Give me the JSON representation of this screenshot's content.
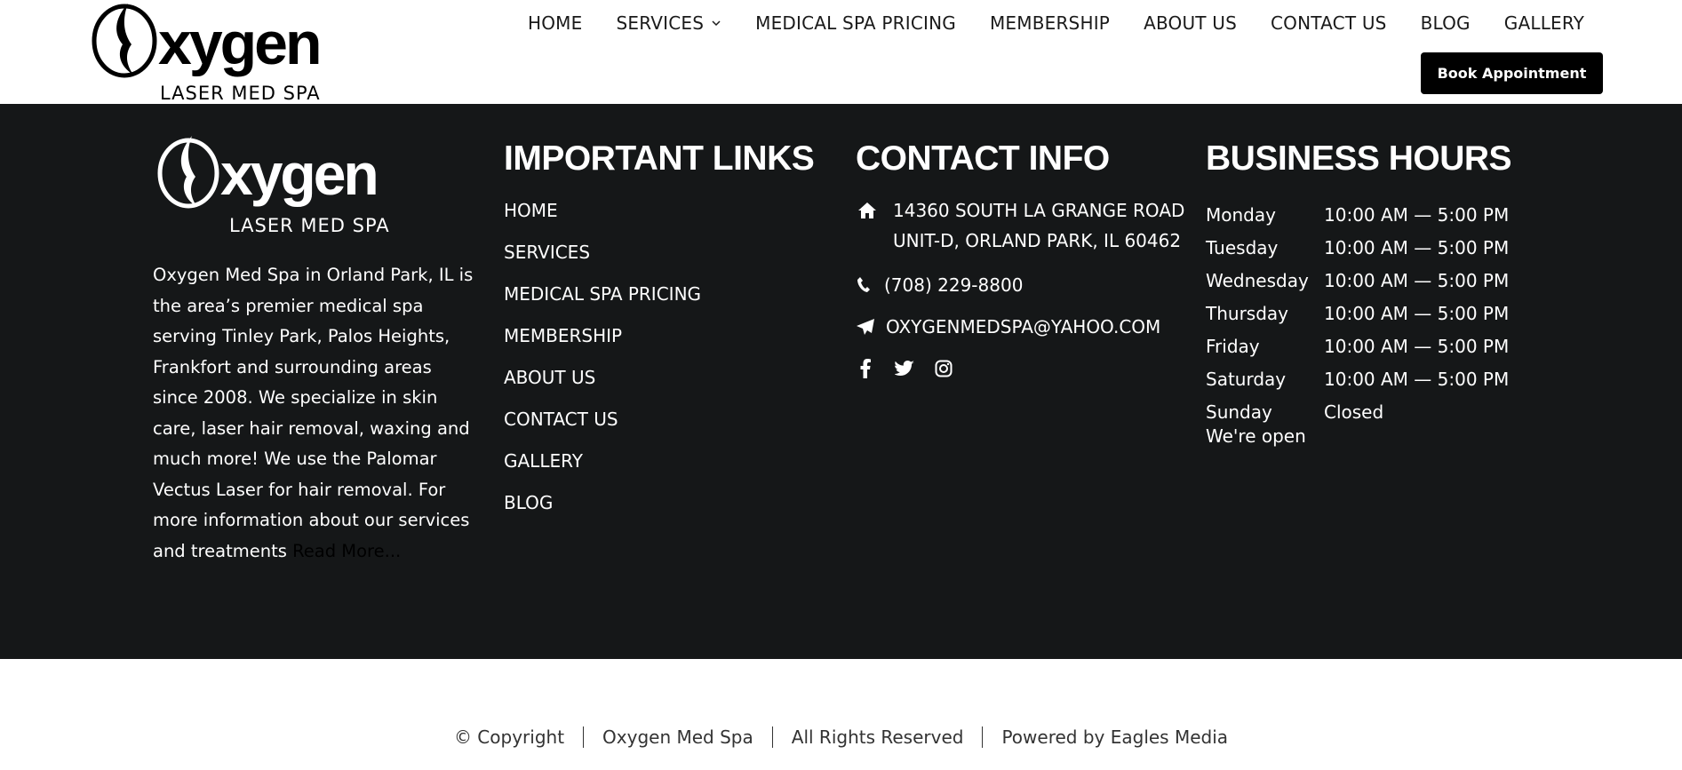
{
  "header": {
    "logo": {
      "word": "xygen",
      "tagline": "LASER MED SPA"
    },
    "nav": [
      "HOME",
      "SERVICES",
      "MEDICAL SPA PRICING",
      "MEMBERSHIP",
      "ABOUT US",
      "CONTACT US",
      "BLOG",
      "GALLERY"
    ],
    "book_button": "Book Appointment"
  },
  "footer": {
    "about_text": "Oxygen Med Spa in Orland Park, IL is the area’s premier medical spa serving Tinley Park, Palos Heights, Frankfort and surrounding areas since 2008. We specialize in skin care, laser hair removal, waxing and much more! We use the Palomar Vectus Laser for hair removal. For more information about our services and treatments",
    "read_more": "Read More...",
    "links_title": "IMPORTANT LINKS",
    "links": [
      "HOME",
      "SERVICES",
      "MEDICAL SPA PRICING",
      "MEMBERSHIP",
      "ABOUT US",
      "CONTACT US",
      "GALLERY",
      "BLOG"
    ],
    "contact_title": "CONTACT INFO",
    "address_line1": "14360 SOUTH LA GRANGE ROAD",
    "address_line2": "UNIT-D, ORLAND PARK, IL 60462",
    "phone": "(708) 229-8800",
    "email": "OXYGENMEDSPA@YAHOO.COM",
    "social": [
      "facebook-icon",
      "twitter-icon",
      "instagram-icon"
    ],
    "hours_title": "BUSINESS HOURS",
    "hours": [
      {
        "day": "Monday",
        "time": "10:00 AM — 5:00 PM"
      },
      {
        "day": "Tuesday",
        "time": "10:00 AM — 5:00 PM"
      },
      {
        "day": "Wednesday",
        "time": "10:00 AM — 5:00 PM"
      },
      {
        "day": "Thursday",
        "time": "10:00 AM — 5:00 PM"
      },
      {
        "day": "Friday",
        "time": "10:00 AM — 5:00 PM"
      },
      {
        "day": "Saturday",
        "time": "10:00 AM — 5:00 PM"
      },
      {
        "day": "Sunday",
        "time": "Closed"
      }
    ],
    "open_status": "We're open"
  },
  "copyright": {
    "parts": [
      "© Copyright",
      "Oxygen Med Spa",
      "All Rights Reserved",
      "Powered by Eagles Media"
    ]
  },
  "colors": {
    "footer_bg": "#151718",
    "button_bg": "#000000"
  }
}
